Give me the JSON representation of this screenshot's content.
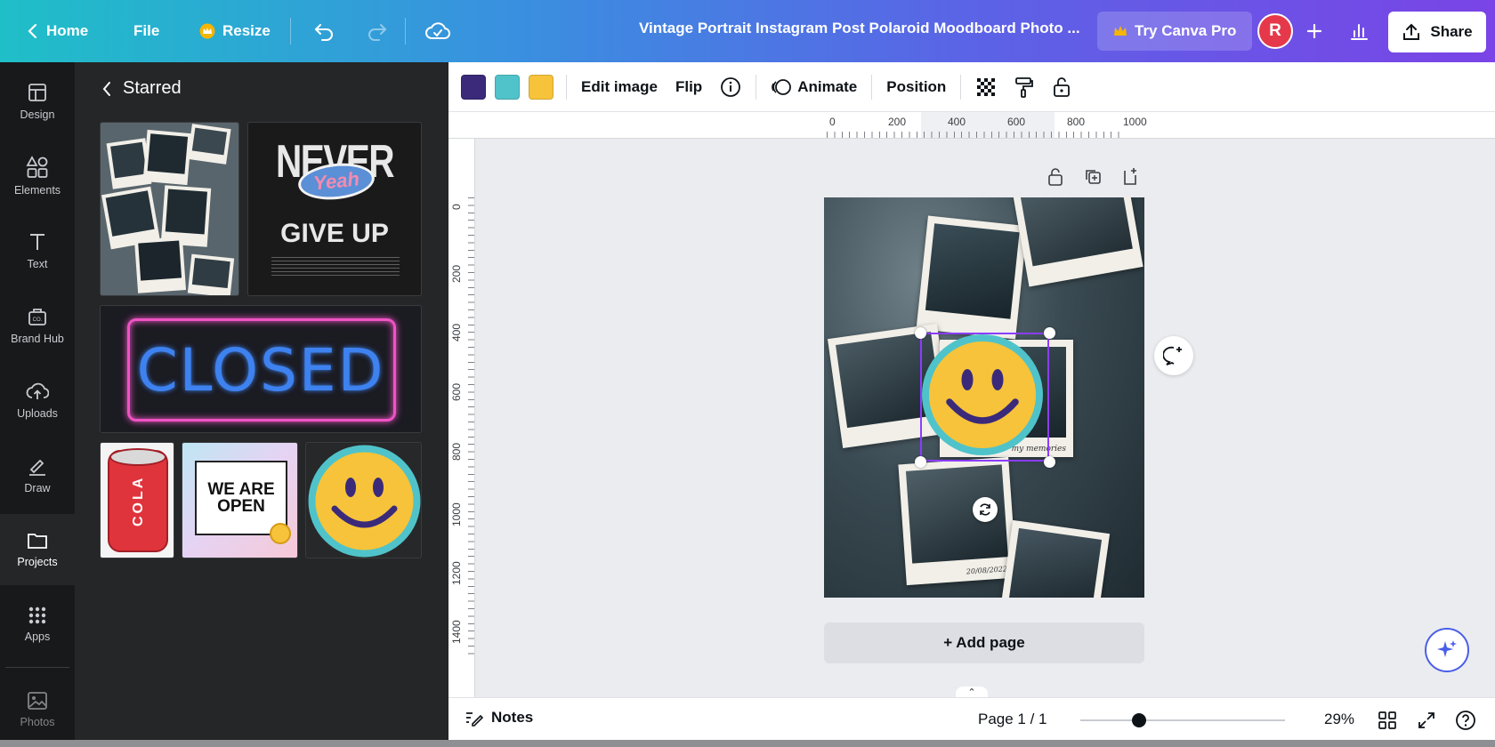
{
  "topbar": {
    "home_label": "Home",
    "file_label": "File",
    "resize_label": "Resize",
    "doc_title": "Vintage Portrait Instagram Post Polaroid Moodboard Photo ...",
    "try_pro_label": "Try Canva Pro",
    "avatar_letter": "R",
    "share_label": "Share"
  },
  "rail": {
    "items": [
      {
        "label": "Design"
      },
      {
        "label": "Elements"
      },
      {
        "label": "Text"
      },
      {
        "label": "Brand Hub"
      },
      {
        "label": "Uploads"
      },
      {
        "label": "Draw"
      },
      {
        "label": "Projects"
      },
      {
        "label": "Apps"
      },
      {
        "label": "Photos"
      }
    ],
    "active": "Projects"
  },
  "panel": {
    "title": "Starred",
    "thumbs": {
      "never": {
        "line1": "NEVER",
        "sticker": "Yeah",
        "line2": "GIVE UP"
      },
      "closed": {
        "text": "CLOSED"
      },
      "cola": {
        "text": "COLA"
      },
      "open": {
        "line1": "WE ARE",
        "line2": "OPEN"
      }
    }
  },
  "context_toolbar": {
    "colors": [
      "#3b2a7a",
      "#4fc3c9",
      "#f6c33a"
    ],
    "edit_image_label": "Edit image",
    "flip_label": "Flip",
    "animate_label": "Animate",
    "position_label": "Position"
  },
  "ruler": {
    "h_labels": [
      "0",
      "200",
      "400",
      "600",
      "800",
      "1000"
    ],
    "v_labels": [
      "0",
      "200",
      "400",
      "600",
      "800",
      "1000",
      "1200",
      "1400"
    ]
  },
  "canvas": {
    "polaroid_caption_1": "my memories",
    "polaroid_caption_2": "20/08/2022",
    "add_page_label": "+ Add page"
  },
  "bottombar": {
    "notes_label": "Notes",
    "page_indicator": "Page 1 / 1",
    "zoom_value": "29%",
    "zoom_percent": 29
  }
}
